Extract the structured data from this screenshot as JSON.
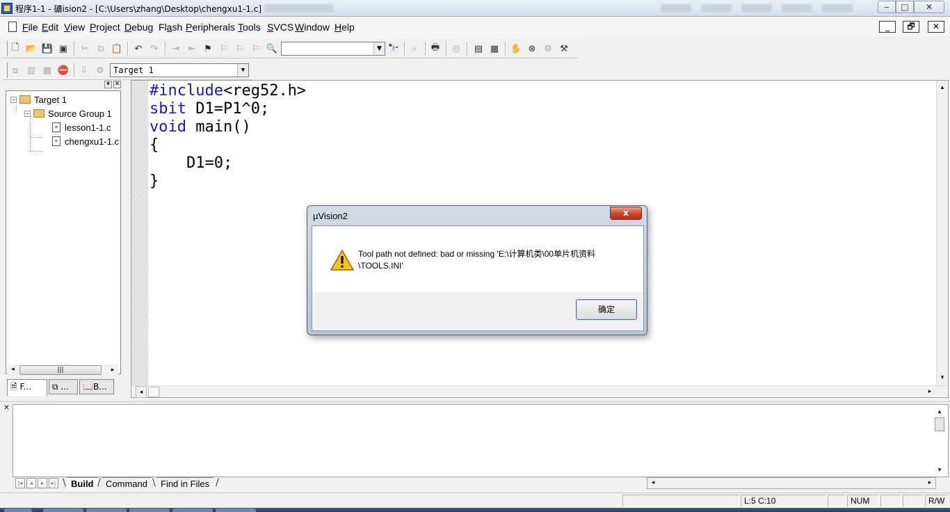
{
  "window": {
    "title": "程序1-1  - 礦ision2 - [C:\\Users\\zhang\\Desktop\\chengxu1-1.c]",
    "min": "‒",
    "max": "□",
    "close": "✕"
  },
  "menu": {
    "items": [
      {
        "u": "F",
        "rest": "ile"
      },
      {
        "u": "E",
        "rest": "dit"
      },
      {
        "u": "V",
        "rest": "iew"
      },
      {
        "u": "P",
        "rest": "roject"
      },
      {
        "u": "D",
        "rest": "ebug"
      },
      {
        "pre": "Fl",
        "u": "a",
        "rest": "sh"
      },
      {
        "u": "P",
        "rest": "eripherals"
      },
      {
        "u": "T",
        "rest": "ools"
      },
      {
        "u": "S",
        "rest": "VCS"
      },
      {
        "u": "W",
        "rest": "indow"
      },
      {
        "u": "H",
        "rest": "elp"
      }
    ],
    "mdi_min": "_",
    "mdi_restore": "🗗",
    "mdi_close": "✕"
  },
  "build_toolbar": {
    "target_select": "Target 1"
  },
  "project": {
    "tree": {
      "target": "Target 1",
      "group": "Source Group 1",
      "files": [
        "lesson1-1.c",
        "chengxu1-1.c"
      ]
    },
    "tabs": [
      "F...",
      "...",
      "B..."
    ]
  },
  "editor": {
    "lines": [
      [
        {
          "t": "#include",
          "kw": true
        },
        {
          "t": "<reg52.h>",
          "kw": false
        }
      ],
      [
        {
          "t": "sbit",
          "kw": true
        },
        {
          "t": " D1=P1^0;",
          "kw": false
        }
      ],
      [
        {
          "t": "void",
          "kw": true
        },
        {
          "t": " main()",
          "kw": false
        }
      ],
      [
        {
          "t": "{",
          "kw": false
        }
      ],
      [
        {
          "t": "    D1=0;",
          "kw": false
        }
      ],
      [
        {
          "t": "}",
          "kw": false
        }
      ]
    ]
  },
  "output": {
    "tabs": [
      "Build",
      "Command",
      "Find in Files"
    ]
  },
  "status": {
    "position": "L:5 C:10",
    "num": "NUM",
    "rw": "R/W"
  },
  "dialog": {
    "title": "µVision2",
    "message_line1": "Tool path not defined: bad or missing 'E:\\计算机类\\00单片机资料",
    "message_line2": "\\TOOLS.INI'",
    "ok_label": "确定",
    "close_glyph": "x"
  }
}
